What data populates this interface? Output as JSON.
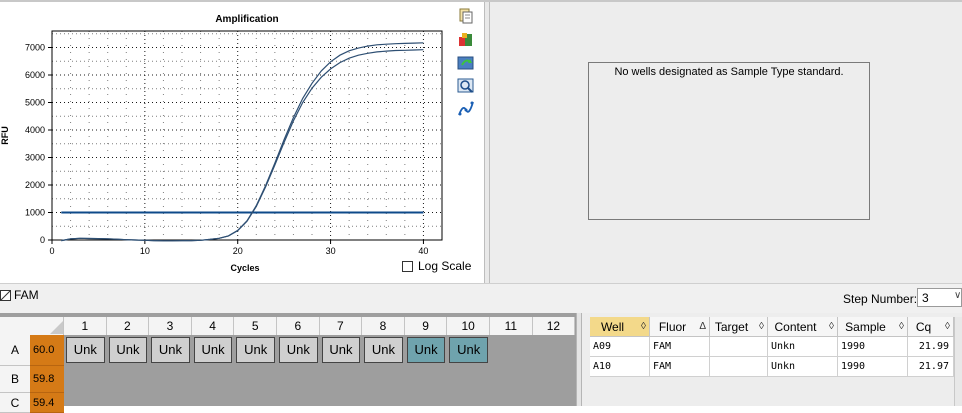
{
  "chart_data": {
    "type": "line",
    "title": "Amplification",
    "xlabel": "Cycles",
    "ylabel": "RFU",
    "xlim": [
      0,
      42
    ],
    "ylim": [
      0,
      7600
    ],
    "xticks": [
      0,
      10,
      20,
      30,
      40
    ],
    "yticks": [
      0,
      1000,
      2000,
      3000,
      4000,
      5000,
      6000,
      7000
    ],
    "grid": true,
    "threshold": 1000,
    "series": [
      {
        "x": [
          1,
          2,
          3,
          4,
          5,
          6,
          7,
          8,
          9,
          10,
          11,
          12,
          13,
          14,
          15,
          16,
          17,
          18,
          19,
          20,
          21,
          22,
          23,
          24,
          25,
          26,
          27,
          28,
          29,
          30,
          31,
          32,
          33,
          34,
          35,
          36,
          37,
          38,
          39,
          40
        ],
        "y": [
          -20,
          40,
          60,
          55,
          50,
          40,
          30,
          10,
          0,
          -10,
          -20,
          -30,
          -30,
          -25,
          -20,
          -10,
          20,
          60,
          150,
          350,
          700,
          1250,
          1980,
          2800,
          3650,
          4450,
          5150,
          5700,
          6150,
          6480,
          6720,
          6880,
          6980,
          7050,
          7100,
          7120,
          7140,
          7150,
          7160,
          7170
        ]
      },
      {
        "x": [
          1,
          2,
          3,
          4,
          5,
          6,
          7,
          8,
          9,
          10,
          11,
          12,
          13,
          14,
          15,
          16,
          17,
          18,
          19,
          20,
          21,
          22,
          23,
          24,
          25,
          26,
          27,
          28,
          29,
          30,
          31,
          32,
          33,
          34,
          35,
          36,
          37,
          38,
          39,
          40
        ],
        "y": [
          -20,
          40,
          60,
          55,
          50,
          40,
          30,
          10,
          0,
          -10,
          -20,
          -30,
          -30,
          -25,
          -20,
          -10,
          20,
          60,
          150,
          340,
          680,
          1220,
          1930,
          2730,
          3550,
          4330,
          5000,
          5520,
          5920,
          6220,
          6450,
          6610,
          6720,
          6790,
          6840,
          6870,
          6890,
          6900,
          6910,
          6920
        ]
      }
    ],
    "colors": {
      "line": "#2e4f73",
      "threshold": "#0e4a8a"
    }
  },
  "toolbar_icons": [
    "copy-icon",
    "export-icon",
    "refresh-icon",
    "zoom-icon",
    "curve-fit-icon"
  ],
  "log_scale": {
    "label": "Log Scale",
    "checked": false
  },
  "std_curve": {
    "message": "No wells designated as Sample Type standard."
  },
  "fluor": {
    "label": "FAM",
    "checked": true
  },
  "step": {
    "label": "Step Number:",
    "value": "3"
  },
  "plate": {
    "columns": [
      "1",
      "2",
      "3",
      "4",
      "5",
      "6",
      "7",
      "8",
      "9",
      "10",
      "11",
      "12"
    ],
    "rows": [
      {
        "label": "A",
        "temp": "60.0",
        "cells": [
          "Unk",
          "Unk",
          "Unk",
          "Unk",
          "Unk",
          "Unk",
          "Unk",
          "Unk",
          "Unk",
          "Unk",
          "",
          ""
        ]
      },
      {
        "label": "B",
        "temp": "59.8",
        "cells": []
      },
      {
        "label": "C",
        "temp": "59.4",
        "cells": []
      }
    ],
    "selected_cols": [
      9,
      10
    ]
  },
  "table": {
    "headers": [
      {
        "label": "Well",
        "sort": "◊"
      },
      {
        "label": "Fluor",
        "sort": "Δ"
      },
      {
        "label": "Target",
        "sort": "◊"
      },
      {
        "label": "Content",
        "sort": "◊"
      },
      {
        "label": "Sample",
        "sort": "◊"
      },
      {
        "label": "Cq",
        "sort": "◊"
      }
    ],
    "rows": [
      {
        "well": "A09",
        "fluor": "FAM",
        "target": "",
        "content": "Unkn",
        "sample": "1990",
        "cq": "21.99"
      },
      {
        "well": "A10",
        "fluor": "FAM",
        "target": "",
        "content": "Unkn",
        "sample": "1990",
        "cq": "21.97"
      }
    ]
  }
}
